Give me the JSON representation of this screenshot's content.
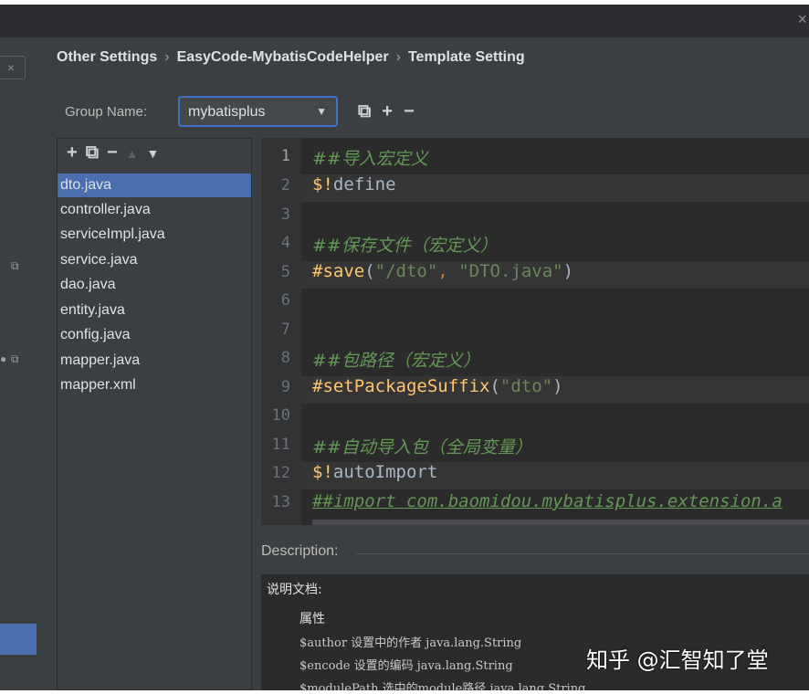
{
  "window": {
    "close_glyph": "×"
  },
  "breadcrumb": [
    "Other Settings",
    "EasyCode-MybatisCodeHelper",
    "Template Setting"
  ],
  "group": {
    "label": "Group Name:",
    "value": "mybatisplus",
    "tools": [
      "copy-icon",
      "plus-icon",
      "minus-icon"
    ]
  },
  "list": {
    "tools": [
      "plus-icon",
      "copy-icon",
      "minus-icon",
      "up-arrow-icon",
      "down-arrow-icon"
    ],
    "items": [
      "dto.java",
      "controller.java",
      "serviceImpl.java",
      "service.java",
      "dao.java",
      "entity.java",
      "config.java",
      "mapper.java",
      "mapper.xml"
    ],
    "selected_index": 0
  },
  "editor": {
    "line_numbers": [
      "1",
      "2",
      "3",
      "4",
      "5",
      "6",
      "7",
      "8",
      "9",
      "10",
      "11",
      "12",
      "13"
    ],
    "lines": {
      "l1": "##导入宏定义",
      "l2_a": "$!",
      "l2_b": "define",
      "l4": "##保存文件（宏定义）",
      "l5_a": "#save",
      "l5_b": "(",
      "l5_c": "\"/dto\"",
      "l5_d": ", ",
      "l5_e": "\"DTO.java\"",
      "l5_f": ")",
      "l8": "##包路径（宏定义）",
      "l9_a": "#setPackageSuffix",
      "l9_b": "(",
      "l9_c": "\"dto\"",
      "l9_d": ")",
      "l11": "##自动导入包（全局变量）",
      "l12_a": "$!",
      "l12_b": "autoImport",
      "l13": "##import com.baomidou.mybatisplus.extension.a"
    }
  },
  "description": {
    "label": "Description:",
    "title": "说明文档:",
    "heading": "属性",
    "lines": [
      "$author 设置中的作者 java.lang.String",
      "$encode 设置的编码 java.lang.String",
      "$modulePath 选中的module路径 java.lang.String"
    ]
  },
  "watermark": "知乎 @汇智知了堂",
  "colors": {
    "accent": "#4b6eaf",
    "focus_border": "#3d74c7",
    "comment": "#629755",
    "keyword": "#ffc66d",
    "string": "#6a8759"
  }
}
